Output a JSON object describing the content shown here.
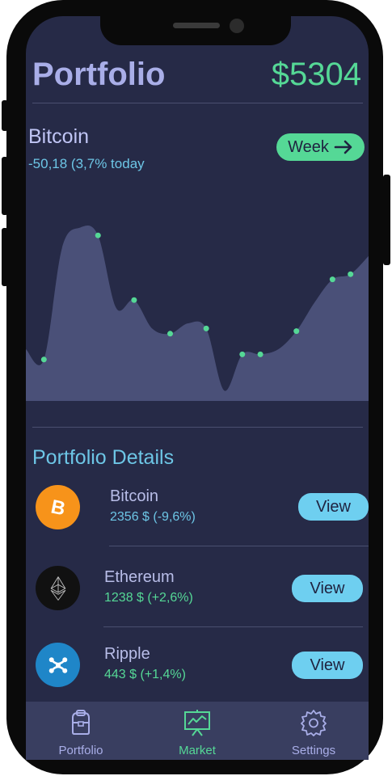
{
  "header": {
    "title": "Portfolio",
    "total": "$5304"
  },
  "chart_section": {
    "coin": "Bitcoin",
    "change": "-50,18 (3,7% today",
    "period_button": "Week"
  },
  "chart_data": {
    "type": "area",
    "points": [
      20,
      16,
      59,
      67,
      64,
      36,
      39,
      28,
      26,
      30,
      28,
      4,
      18,
      18,
      20,
      27,
      38,
      47,
      49,
      56
    ]
  },
  "details": {
    "title": "Portfolio Details",
    "items": [
      {
        "name": "Bitcoin",
        "value": "2356 $ (-9,6%)",
        "value_color": "#6dc6e6",
        "action": "View",
        "icon": "bitcoin-icon"
      },
      {
        "name": "Ethereum",
        "value": "1238 $ (+2,6%)",
        "value_color": "#55d896",
        "action": "View",
        "icon": "ethereum-icon"
      },
      {
        "name": "Ripple",
        "value": "443 $ (+1,4%)",
        "value_color": "#55d896",
        "action": "View",
        "icon": "ripple-icon"
      }
    ]
  },
  "tabs": [
    {
      "label": "Portfolio",
      "icon": "briefcase-icon",
      "active": false
    },
    {
      "label": "Market",
      "icon": "chart-board-icon",
      "active": true
    },
    {
      "label": "Settings",
      "icon": "gear-icon",
      "active": false
    }
  ],
  "colors": {
    "background": "#262a47",
    "accent_green": "#55d896",
    "accent_blue": "#6ecff0",
    "chart_fill": "#4a5078",
    "tabbar": "#393e60",
    "inactive_tab": "#a9aee8"
  }
}
